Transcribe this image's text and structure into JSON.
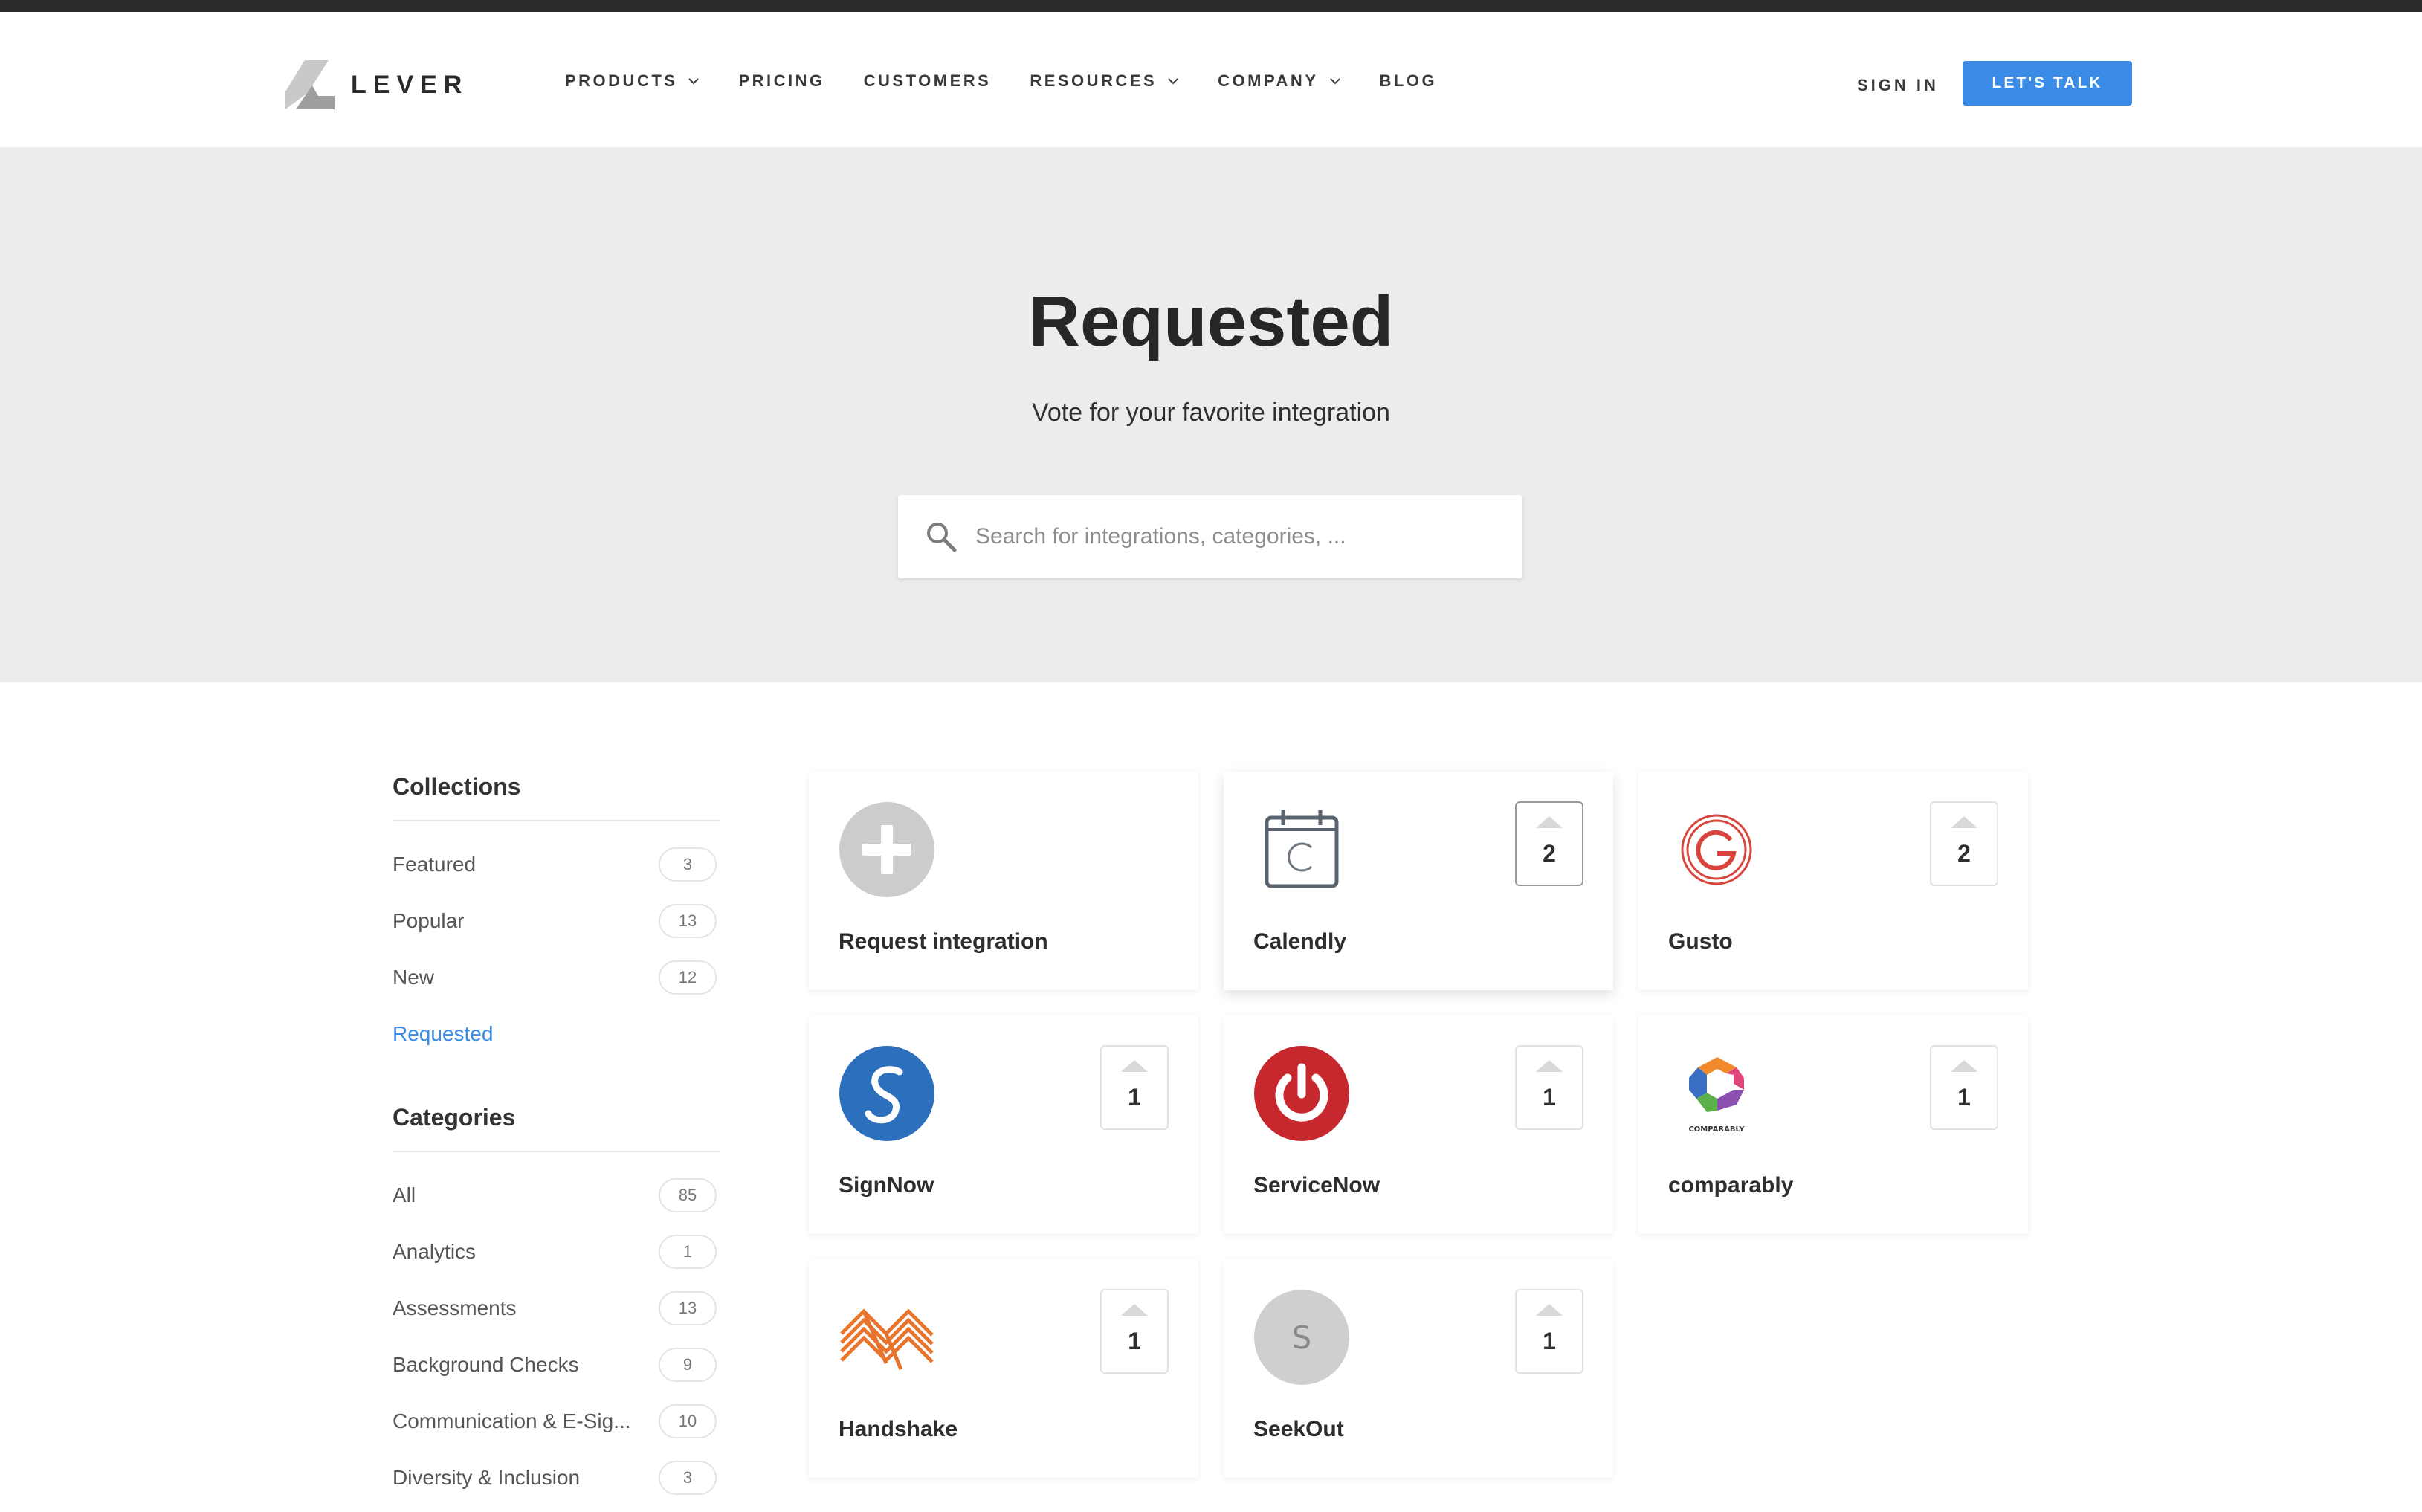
{
  "brand": {
    "name": "LEVER"
  },
  "nav": {
    "links": [
      {
        "label": "PRODUCTS",
        "dropdown": true
      },
      {
        "label": "PRICING",
        "dropdown": false
      },
      {
        "label": "CUSTOMERS",
        "dropdown": false
      },
      {
        "label": "RESOURCES",
        "dropdown": true
      },
      {
        "label": "COMPANY",
        "dropdown": true
      },
      {
        "label": "BLOG",
        "dropdown": false
      }
    ],
    "sign_in": "SIGN IN",
    "cta": "LET'S TALK"
  },
  "hero": {
    "title": "Requested",
    "subtitle": "Vote for your favorite integration",
    "search_placeholder": "Search for integrations, categories, ..."
  },
  "sidebar": {
    "collections_heading": "Collections",
    "collections": [
      {
        "label": "Featured",
        "count": "3"
      },
      {
        "label": "Popular",
        "count": "13"
      },
      {
        "label": "New",
        "count": "12"
      },
      {
        "label": "Requested",
        "count": ""
      }
    ],
    "categories_heading": "Categories",
    "categories": [
      {
        "label": "All",
        "count": "85"
      },
      {
        "label": "Analytics",
        "count": "1"
      },
      {
        "label": "Assessments",
        "count": "13"
      },
      {
        "label": "Background Checks",
        "count": "9"
      },
      {
        "label": "Communication & E-Sig...",
        "count": "10"
      },
      {
        "label": "Diversity & Inclusion",
        "count": "3"
      }
    ]
  },
  "cards": {
    "request": {
      "name": "Request integration"
    },
    "calendly": {
      "name": "Calendly",
      "votes": "2"
    },
    "gusto": {
      "name": "Gusto",
      "votes": "2"
    },
    "signnow": {
      "name": "SignNow",
      "votes": "1"
    },
    "servicenow": {
      "name": "ServiceNow",
      "votes": "1"
    },
    "comparably": {
      "name": "comparably",
      "votes": "1",
      "logo_text": "COMPARABLY"
    },
    "handshake": {
      "name": "Handshake",
      "votes": "1"
    },
    "seekout": {
      "name": "SeekOut",
      "votes": "1",
      "logo_letter": "S"
    }
  },
  "colors": {
    "accent": "#3a8be6",
    "hero_bg": "#ececec",
    "topbar": "#2b2b2b"
  }
}
